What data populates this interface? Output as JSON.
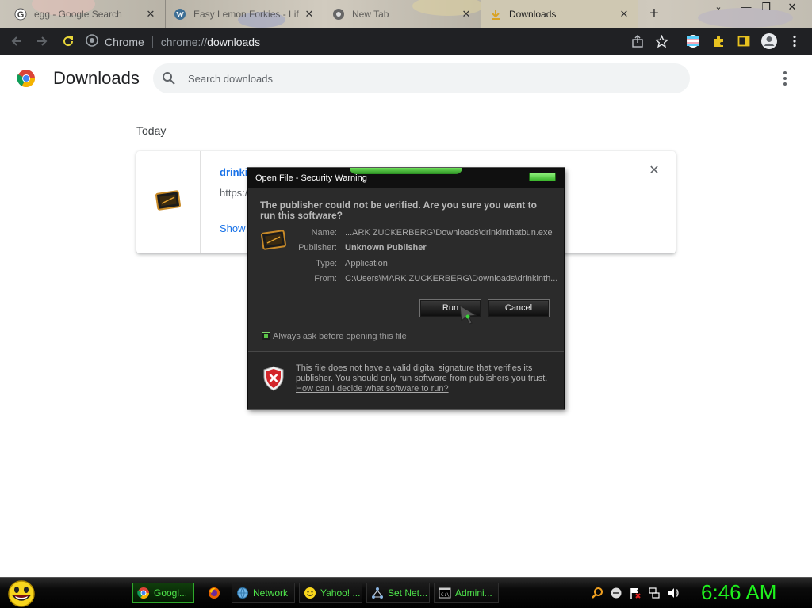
{
  "browser": {
    "tabs": [
      {
        "title": "egg - Google Search",
        "icon": "google-icon"
      },
      {
        "title": "Easy Lemon Forkies - Lif",
        "icon": "wordpress-icon"
      },
      {
        "title": "New Tab",
        "icon": "chrome-icon"
      },
      {
        "title": "Downloads",
        "icon": "download-icon",
        "active": true
      }
    ],
    "newtab_label": "+",
    "close_glyph": "✕",
    "window_controls": {
      "minimize": "—",
      "restore": "❐",
      "close": "✕"
    },
    "omnibox": {
      "site_label": "Chrome",
      "url_scheme": "chrome://",
      "url_host": "downloads"
    }
  },
  "downloads_page": {
    "title": "Downloads",
    "search_placeholder": "Search downloads",
    "date_group": "Today",
    "item": {
      "filename": "drinkin",
      "url": "https:/",
      "action": "Show",
      "remove_glyph": "✕"
    }
  },
  "dialog": {
    "title": "Open File - Security Warning",
    "headline": "The publisher could not be verified.  Are you sure you want to run this software?",
    "fields": [
      {
        "label": "Name:",
        "value": "...ARK ZUCKERBERG\\Downloads\\drinkinthatbun.exe"
      },
      {
        "label": "Publisher:",
        "value": "Unknown Publisher"
      },
      {
        "label": "Type:",
        "value": "Application"
      },
      {
        "label": "From:",
        "value": "C:\\Users\\MARK ZUCKERBERG\\Downloads\\drinkinth..."
      }
    ],
    "run_button": "Run",
    "cancel_button": "Cancel",
    "checkbox_label": "Always ask before opening this file",
    "checkbox_checked": true,
    "info_text": "This file does not have a valid digital signature that verifies its publisher.  You should only run software from publishers you trust.",
    "info_link": "How can I decide what software to run?"
  },
  "taskbar": {
    "buttons": [
      {
        "label": "Googl...",
        "icon": "chrome-icon",
        "state": "active"
      },
      {
        "label": "",
        "icon": "firefox-icon",
        "state": "plain"
      },
      {
        "label": "Network",
        "icon": "network-globe-icon",
        "state": "outlined"
      },
      {
        "label": "Yahoo! ...",
        "icon": "smiley-icon",
        "state": "outlined"
      },
      {
        "label": "Set Net...",
        "icon": "network-setup-icon",
        "state": "outlined"
      },
      {
        "label": "Admini...",
        "icon": "command-prompt-icon",
        "state": "outlined"
      }
    ],
    "clock": "6:46 AM"
  },
  "colors": {
    "link_blue": "#1a73e8",
    "taskbar_green": "#4ee44a",
    "clock_green": "#1ff11d",
    "dialog_bg": "#2b2b2b"
  }
}
